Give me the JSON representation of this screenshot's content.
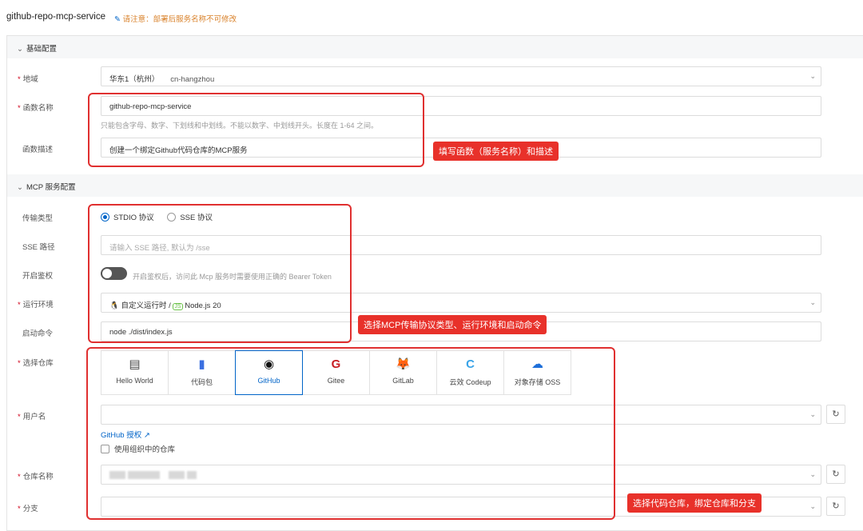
{
  "header": {
    "service_name": "github-repo-mcp-service",
    "warning": "请注意：部署后服务名称不可修改",
    "edit_icon": "pencil-icon"
  },
  "basic": {
    "section_title": "基础配置",
    "region": {
      "label": "地域",
      "value": "华东1（杭州）",
      "code": "cn-hangzhou"
    },
    "function_name": {
      "label": "函数名称",
      "value": "github-repo-mcp-service",
      "hint": "只能包含字母、数字、下划线和中划线。不能以数字、中划线开头。长度在 1-64 之间。"
    },
    "description": {
      "label": "函数描述",
      "value": "创建一个绑定Github代码仓库的MCP服务"
    }
  },
  "mcp": {
    "section_title": "MCP 服务配置",
    "transport": {
      "label": "传输类型",
      "options": [
        "STDIO 协议",
        "SSE 协议"
      ],
      "selected": "STDIO 协议"
    },
    "sse_path": {
      "label": "SSE 路径",
      "placeholder": "请输入 SSE 路径, 默认为 /sse"
    },
    "auth": {
      "label": "开启鉴权",
      "enabled": false,
      "hint": "开启鉴权后，访问此 Mcp 服务时需要使用正确的 Bearer Token"
    },
    "runtime": {
      "label": "运行环境",
      "custom": "自定义运行时 /",
      "value": "Node.js 20"
    },
    "command": {
      "label": "启动命令",
      "value": "node ./dist/index.js"
    },
    "repo": {
      "label": "选择仓库",
      "sources": [
        "Hello World",
        "代码包",
        "GitHub",
        "Gitee",
        "GitLab",
        "云效 Codeup",
        "对象存储 OSS"
      ],
      "selected": "GitHub"
    },
    "username": {
      "label": "用户名",
      "value": "",
      "auth_link": "GitHub 授权",
      "org_checkbox": "使用组织中的仓库",
      "org_checked": false
    },
    "repo_name": {
      "label": "仓库名称"
    },
    "branch": {
      "label": "分支",
      "value": ""
    }
  },
  "annotations": [
    "填写函数（服务名称）和描述",
    "选择MCP传输协议类型、运行环境和启动命令",
    "选择代码仓库，绑定仓库和分支"
  ],
  "colors": {
    "accent": "#0064c8",
    "annotation": "#e8312a",
    "warning": "#d9822b"
  }
}
